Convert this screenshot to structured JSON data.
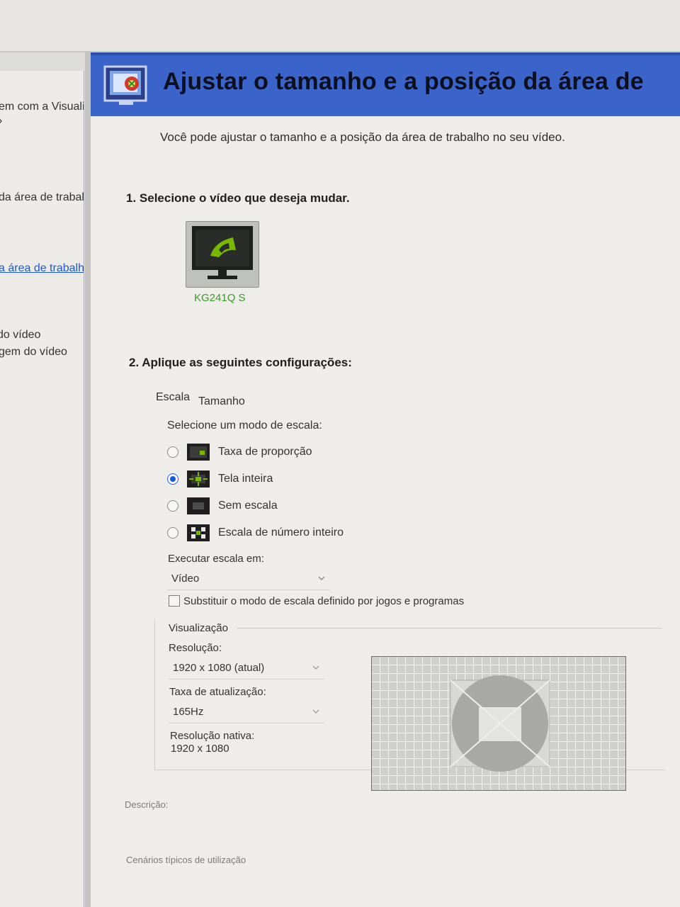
{
  "left_nav": {
    "items": [
      {
        "label": "em com a Visuali",
        "active": false
      },
      {
        "label": "da área de trabal",
        "active": false
      },
      {
        "label": "a área de trabalh",
        "active": true
      },
      {
        "label": " do vídeo",
        "active": false
      },
      {
        "label": "gem do vídeo",
        "active": false
      }
    ]
  },
  "header": {
    "title": "Ajustar o tamanho e a posição da área de",
    "icon": "display-settings-icon",
    "color": "#3a64c9"
  },
  "subtitle": "Você pode ajustar o tamanho e a posição da área de trabalho no seu vídeo.",
  "step1": {
    "heading": "1. Selecione o vídeo que deseja mudar.",
    "display_name": "KG241Q S",
    "display_icon": "nvidia-monitor-icon",
    "display_label_color": "#3a9a2c"
  },
  "step2": {
    "heading": "2. Aplique as seguintes configurações:",
    "tabs": [
      "Escala",
      "Tamanho"
    ],
    "scale_mode_label": "Selecione um modo de escala:",
    "modes": [
      {
        "label": "Taxa de proporção",
        "icon": "aspect-ratio-icon",
        "checked": false
      },
      {
        "label": "Tela inteira",
        "icon": "full-screen-icon",
        "checked": true
      },
      {
        "label": "Sem escala",
        "icon": "no-scaling-icon",
        "checked": false
      },
      {
        "label": "Escala de número inteiro",
        "icon": "integer-scaling-icon",
        "checked": false
      }
    ],
    "perform_scaling_label": "Executar escala em:",
    "perform_scaling_value": "Vídeo",
    "override_label": "Substituir o modo de escala definido por jogos e programas",
    "override_checked": false,
    "preview_label": "Visualização",
    "resolution_label": "Resolução:",
    "resolution_value": "1920 x 1080 (atual)",
    "refresh_label": "Taxa de atualização:",
    "refresh_value": "165Hz",
    "native_label": "Resolução nativa:",
    "native_value": "1920 x 1080"
  },
  "footer": {
    "description_label": "Descrição:",
    "scenarios_label": "Cenários típicos de utilização"
  },
  "colors": {
    "accent": "#1a5ad6",
    "nvidia_green": "#76b900"
  }
}
